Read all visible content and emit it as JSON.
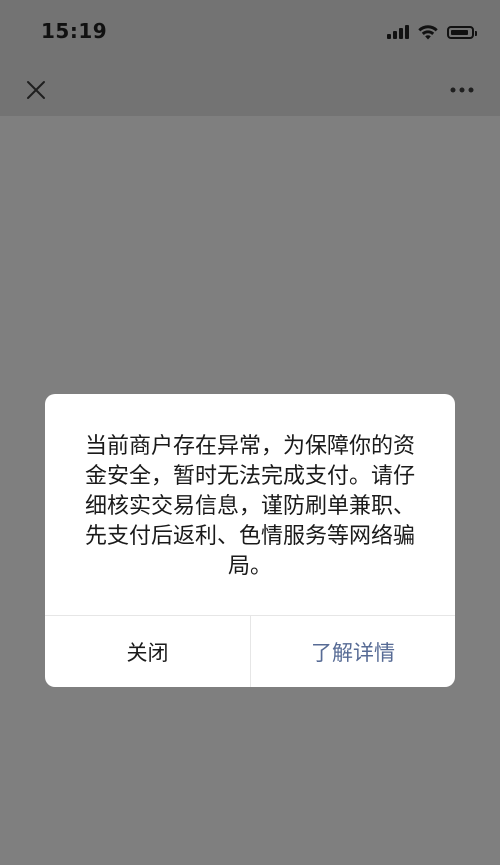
{
  "status_bar": {
    "time": "15:19"
  },
  "nav": {
    "close_icon": "close-icon",
    "more_icon": "more-horizontal-icon"
  },
  "dialog": {
    "message": "当前商户存在异常，为保障你的资金安全，暂时无法完成支付。请仔细核实交易信息，谨防刷单兼职、先支付后返利、色情服务等网络骗局。",
    "cancel_label": "关闭",
    "detail_label": "了解详情",
    "detail_color": "#576b95"
  },
  "colors": {
    "overlay_background": "#7f7f7f",
    "header_background": "#737373",
    "dialog_background": "#ffffff",
    "link_color": "#576b95"
  }
}
